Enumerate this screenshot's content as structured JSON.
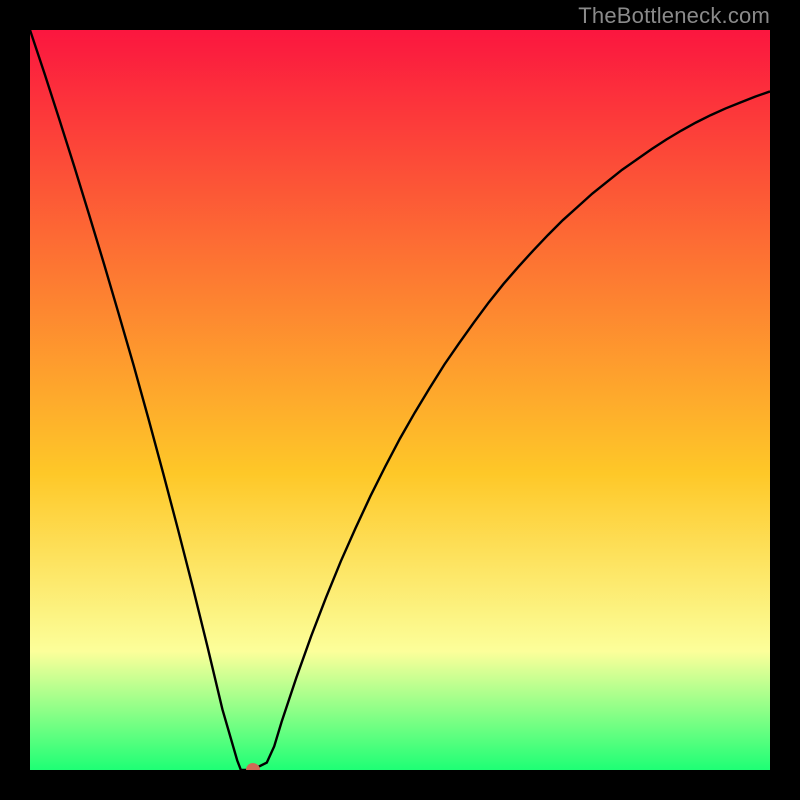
{
  "watermark": "TheBottleneck.com",
  "colors": {
    "top": "#fb163f",
    "mid1": "#fd7033",
    "mid2": "#fec828",
    "pale": "#fcff9a",
    "bottom": "#1eff75",
    "curve": "#000000",
    "marker": "#cf6a56",
    "frame": "#000000"
  },
  "chart_data": {
    "type": "line",
    "title": "",
    "xlabel": "",
    "ylabel": "",
    "ylim": [
      0,
      100
    ],
    "xlim": [
      0,
      1
    ],
    "x": [
      0.0,
      0.02,
      0.04,
      0.06,
      0.08,
      0.1,
      0.12,
      0.14,
      0.16,
      0.18,
      0.2,
      0.22,
      0.24,
      0.26,
      0.28,
      0.285,
      0.3,
      0.32,
      0.33,
      0.34,
      0.36,
      0.38,
      0.4,
      0.42,
      0.44,
      0.46,
      0.48,
      0.5,
      0.52,
      0.54,
      0.56,
      0.58,
      0.6,
      0.62,
      0.64,
      0.66,
      0.68,
      0.7,
      0.72,
      0.74,
      0.76,
      0.78,
      0.8,
      0.82,
      0.84,
      0.86,
      0.88,
      0.9,
      0.92,
      0.94,
      0.96,
      0.98,
      1.0
    ],
    "values": [
      100.0,
      94.0,
      87.8,
      81.5,
      75.0,
      68.4,
      61.6,
      54.7,
      47.5,
      40.1,
      32.5,
      24.7,
      16.6,
      8.2,
      1.3,
      0.0,
      0.0,
      1.0,
      3.2,
      6.5,
      12.5,
      18.1,
      23.3,
      28.2,
      32.7,
      37.0,
      41.0,
      44.8,
      48.3,
      51.6,
      54.8,
      57.7,
      60.5,
      63.2,
      65.7,
      68.0,
      70.2,
      72.3,
      74.3,
      76.1,
      77.9,
      79.5,
      81.1,
      82.5,
      83.9,
      85.2,
      86.4,
      87.5,
      88.5,
      89.4,
      90.2,
      91.0,
      91.7
    ],
    "marker": {
      "x": 0.302,
      "y": 0.0
    }
  }
}
